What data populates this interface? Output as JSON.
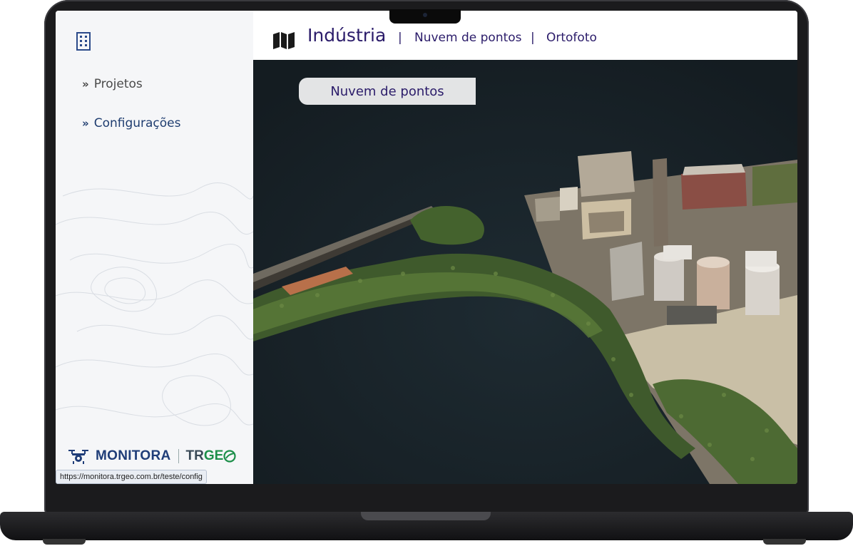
{
  "header": {
    "title": "Indústria",
    "separator": "|",
    "links": [
      "Nuvem de pontos",
      "Ortofoto"
    ]
  },
  "sidebar": {
    "items": [
      {
        "label": "Projetos"
      },
      {
        "label": "Configurações"
      }
    ],
    "chevron": "»"
  },
  "viewer": {
    "tab_label": "Nuvem de pontos"
  },
  "footer": {
    "brand": "MONITORA",
    "partner_prefix": "TR",
    "partner_suffix": "GE"
  },
  "status": {
    "url": "https://monitora.trgeo.com.br/teste/config"
  },
  "colors": {
    "accent": "#2b1c6a",
    "nav_active": "#1f3d70",
    "brand_blue": "#1f3d78",
    "brand_green": "#1d8f4a",
    "viewer_bg": "#1a232a"
  },
  "icons": {
    "brand": "building-icon",
    "header": "map-icon",
    "nav": "chevron-right-double-icon"
  }
}
